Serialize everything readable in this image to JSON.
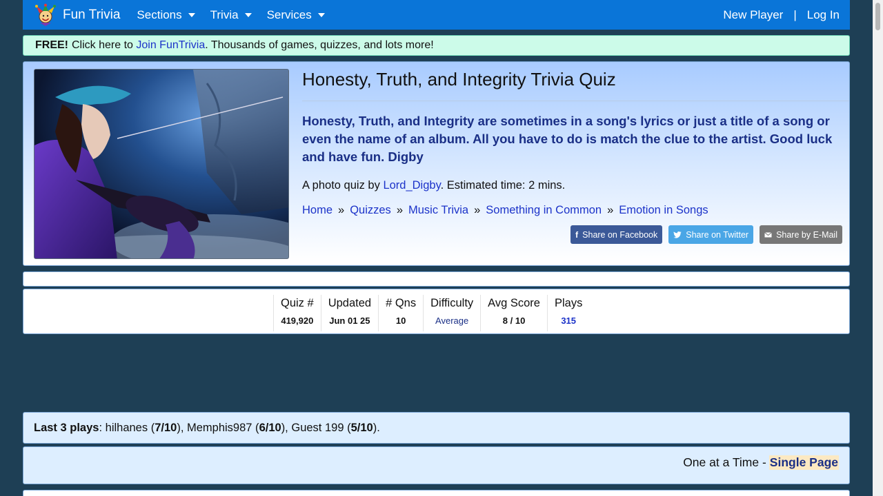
{
  "nav": {
    "brand": "Fun Trivia",
    "menus": [
      {
        "label": "Sections"
      },
      {
        "label": "Trivia"
      },
      {
        "label": "Services"
      }
    ],
    "new_player": "New Player",
    "separator": "|",
    "login": "Log In"
  },
  "promo": {
    "free": "FREE!",
    "pre_text": "Click here to",
    "link": "Join FunTrivia",
    "post_text": ". Thousands of games, quizzes, and lots more!"
  },
  "quiz": {
    "title": "Honesty, Truth, and Integrity Trivia Quiz",
    "description": "Honesty, Truth, and Integrity are sometimes in a song's lyrics or just a title of a song or even the name of an album. All you have to do is match the clue to the artist. Good luck and have fun. Digby",
    "byline_pre": "A photo quiz by",
    "author": "Lord_Digby",
    "byline_post": ". Estimated time: 2 mins.",
    "breadcrumbs": [
      "Home",
      "Quizzes",
      "Music Trivia",
      "Something in Common",
      "Emotion in Songs"
    ],
    "crumb_sep": "»",
    "share": {
      "facebook": "Share on Facebook",
      "twitter": "Share on Twitter",
      "email": "Share by E-Mail"
    }
  },
  "stats": [
    {
      "label": "Quiz #",
      "value": "419,920"
    },
    {
      "label": "Updated",
      "value": "Jun 01 25"
    },
    {
      "label": "# Qns",
      "value": "10"
    },
    {
      "label": "Difficulty",
      "value": "Average"
    },
    {
      "label": "Avg Score",
      "value": "8 / 10"
    },
    {
      "label": "Plays",
      "value": "315"
    }
  ],
  "last_plays": {
    "label": "Last 3 plays",
    "entries": [
      {
        "name": "hilhanes",
        "score": "7/10"
      },
      {
        "name": "Memphis987",
        "score": "6/10"
      },
      {
        "name": "Guest 199",
        "score": "5/10"
      }
    ]
  },
  "mode": {
    "text": "One at a Time -",
    "link": "Single Page"
  },
  "colors": {
    "nav": "#0a75d8",
    "background": "#1e3f55",
    "link": "#1c33c9",
    "description": "#1a2f86"
  }
}
